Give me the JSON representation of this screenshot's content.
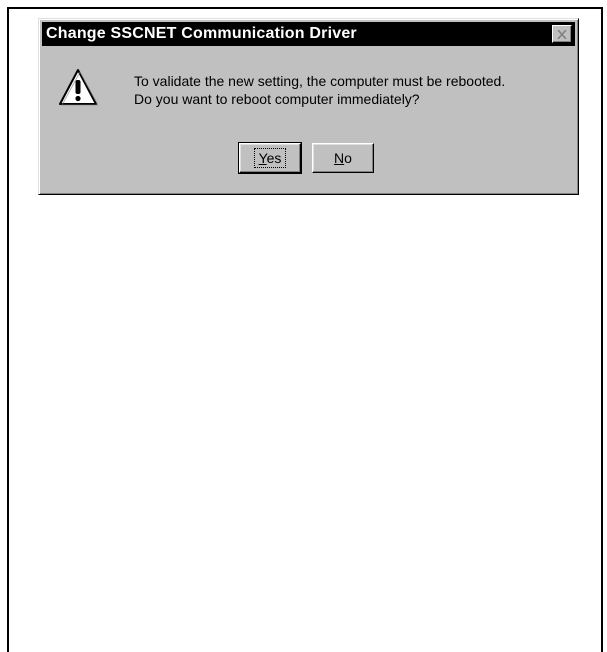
{
  "dialog": {
    "title": "Change SSCNET Communication Driver",
    "message_line1": "To validate the new setting, the computer must be rebooted.",
    "message_line2": "Do you want to reboot computer immediately?",
    "icon": "warning-icon",
    "buttons": {
      "yes_accel": "Y",
      "yes_rest": "es",
      "no_accel": "N",
      "no_rest": "o"
    },
    "close_icon": "close-icon"
  }
}
